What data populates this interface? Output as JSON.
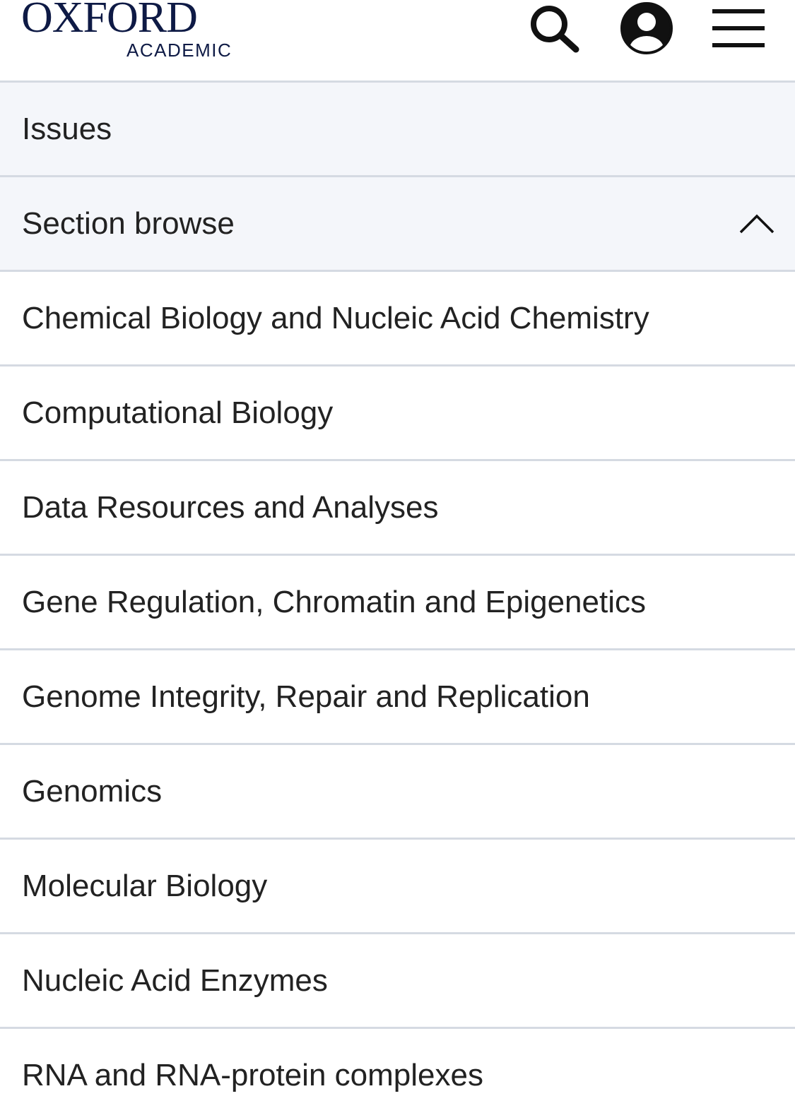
{
  "header": {
    "logo_top": "OXFORD",
    "logo_bottom": "ACADEMIC",
    "brand_color": "#0e1a45",
    "icons": {
      "search": "search-icon",
      "account": "user-account-icon",
      "menu": "hamburger-menu-icon"
    }
  },
  "nav": {
    "issues_label": "Issues",
    "section_browse_label": "Section browse",
    "section_browse_expanded": true,
    "sections": [
      "Chemical Biology and Nucleic Acid Chemistry",
      "Computational Biology",
      "Data Resources and Analyses",
      "Gene Regulation, Chromatin and Epigenetics",
      "Genome Integrity, Repair and Replication",
      "Genomics",
      "Molecular Biology",
      "Nucleic Acid Enzymes",
      "RNA and RNA-protein complexes"
    ]
  },
  "colors": {
    "row_shaded_bg": "#f4f6fa",
    "divider": "#d5dae2",
    "text": "#222222"
  }
}
